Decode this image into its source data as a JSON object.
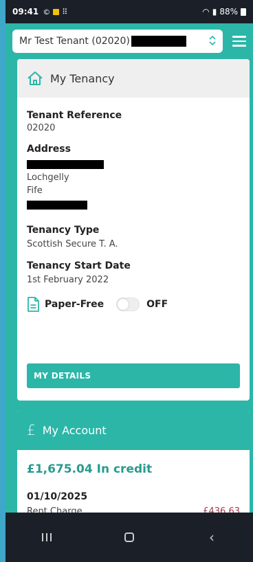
{
  "status": {
    "time": "09:41",
    "battery": "88%"
  },
  "header": {
    "tenant_select_value": "Mr Test Tenant (02020)"
  },
  "tenancy_card": {
    "title": "My Tenancy",
    "tenant_reference_label": "Tenant Reference",
    "tenant_reference_value": "02020",
    "address_label": "Address",
    "address_lines": [
      "Lochgelly",
      "Fife"
    ],
    "tenancy_type_label": "Tenancy Type",
    "tenancy_type_value": "Scottish Secure T. A.",
    "start_date_label": "Tenancy Start Date",
    "start_date_value": "1st February 2022",
    "paper_free_label": "Paper-Free",
    "paper_free_state": "OFF",
    "my_details_button": "MY DETAILS"
  },
  "account_card": {
    "title": "My Account",
    "currency_symbol": "£",
    "balance_text": "£1,675.04 In credit",
    "transactions": [
      {
        "date": "01/10/2025",
        "description": "Rent Charge",
        "amount": "£436.63"
      }
    ]
  },
  "colors": {
    "teal": "#2bb6a8",
    "credit": "#2a9a8f",
    "charge": "#a33a4d",
    "frame": "#3fa7c9",
    "system_bar": "#1a1f28"
  },
  "icons": {
    "home": "home-icon",
    "document": "document-icon",
    "menu": "hamburger-menu-icon",
    "chevron": "chevron-up-down-icon",
    "nav_recents": "recents-icon",
    "nav_home": "home-nav-icon",
    "nav_back": "back-icon"
  }
}
